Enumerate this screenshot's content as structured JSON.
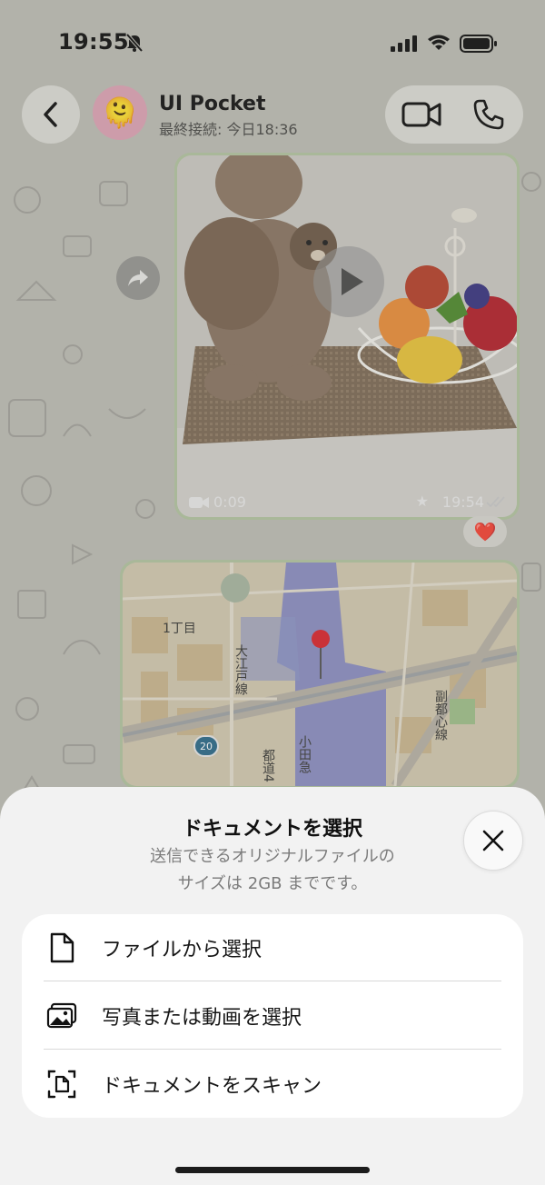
{
  "status_bar": {
    "time": "19:55",
    "icons": [
      "bell-slash-icon",
      "signal-icon",
      "wifi-icon",
      "battery-icon"
    ]
  },
  "header": {
    "contact_name": "UI Pocket",
    "contact_status": "最終接続: 今日18:36",
    "avatar_emoji": "🫠",
    "buttons": [
      "back-button",
      "video-call-button",
      "voice-call-button"
    ]
  },
  "messages": {
    "video": {
      "duration": "0:09",
      "time": "19:54",
      "starred": true,
      "reaction": "❤️"
    },
    "map": {
      "labels": [
        "1丁目",
        "大江戸線",
        "副都心線",
        "都道4",
        "小田急",
        "20"
      ]
    }
  },
  "sheet": {
    "title": "ドキュメントを選択",
    "subtitle_line1": "送信できるオリジナルファイルの",
    "subtitle_line2": "サイズは 2GB までです。",
    "options": [
      {
        "label": "ファイルから選択",
        "icon": "file-icon"
      },
      {
        "label": "写真または動画を選択",
        "icon": "photo-icon"
      },
      {
        "label": "ドキュメントをスキャン",
        "icon": "scan-document-icon"
      }
    ]
  },
  "colors": {
    "bubble_border": "#b2c4a0",
    "sheet_background": "#f2f2f2",
    "reaction_heart": "#d0303a"
  }
}
